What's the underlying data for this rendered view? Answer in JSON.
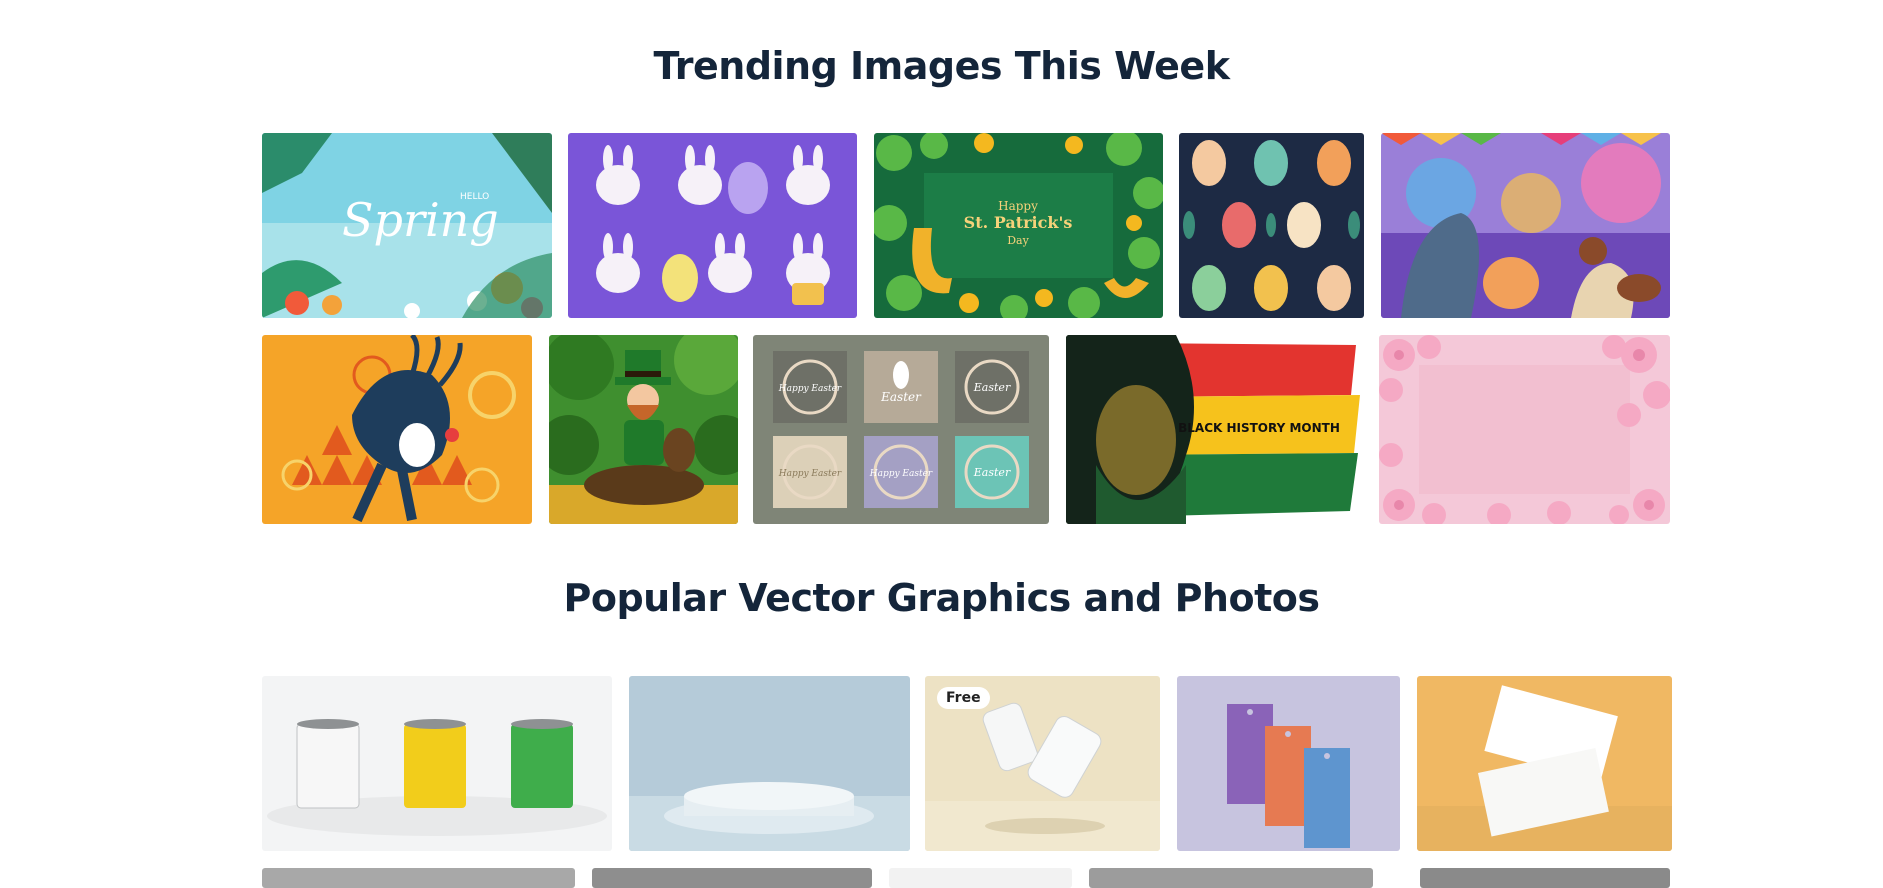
{
  "sections": {
    "trending_title": "Trending Images This Week",
    "popular_title": "Popular Vector Graphics and Photos"
  },
  "trending": [
    {
      "name": "spring-banner",
      "caption_small": "HELLO",
      "caption": "Spring"
    },
    {
      "name": "easter-bunnies-set"
    },
    {
      "name": "st-patricks-day-card",
      "caption_small": "Happy",
      "caption": "St. Patrick's",
      "caption_sub": "Day"
    },
    {
      "name": "easter-eggs-pattern"
    },
    {
      "name": "holi-festival-illustration"
    },
    {
      "name": "african-dancer-illustration"
    },
    {
      "name": "leprechaun-illustration"
    },
    {
      "name": "happy-easter-cards",
      "cards": [
        "Happy Easter",
        "Easter",
        "Easter",
        "Happy Easter",
        "Happy Easter",
        "Easter"
      ]
    },
    {
      "name": "black-history-month-banner",
      "caption": "BLACK HISTORY MONTH"
    },
    {
      "name": "cherry-blossom-frame"
    }
  ],
  "popular": [
    {
      "name": "paint-cans-mockup"
    },
    {
      "name": "podium-mockup"
    },
    {
      "name": "soda-cans-mockup",
      "badge": "Free"
    },
    {
      "name": "hang-tags-mockup"
    },
    {
      "name": "business-cards-mockup"
    }
  ]
}
